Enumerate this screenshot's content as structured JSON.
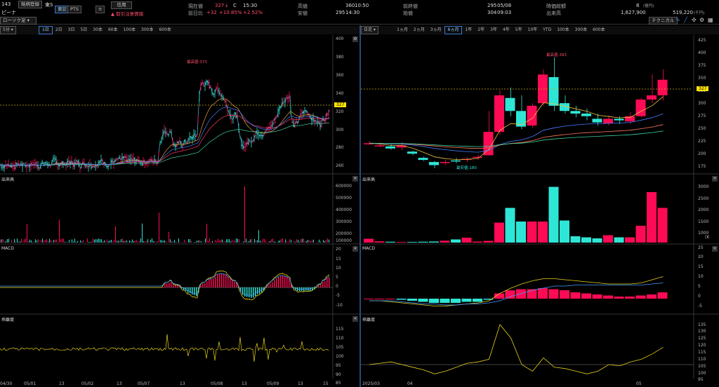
{
  "header": {
    "code": "143",
    "title": "ピーナ",
    "register_btn": "銘柄登録",
    "market": "東S",
    "tab_tse": "東証",
    "tab_pts": "PTS",
    "credit_btn": "信用",
    "warning": "▲ 取引注意情報",
    "chart_type": "ローソク足",
    "price_label": "現在値",
    "price": "327",
    "price_flag": "↓",
    "price_c": "C",
    "price_time": "15:30",
    "change_label": "前日比",
    "change": "+32",
    "change_pct": "+10.85%",
    "change2": "+2.52%",
    "high_label": "高値",
    "high": "360",
    "high_time": "10:50",
    "low_label": "安値",
    "low": "295",
    "low_time": "14:30",
    "prev_label": "前終値",
    "prev": "295",
    "prev_date": "05/08",
    "open_label": "始値",
    "open": "304",
    "open_time": "09:03",
    "mcap_label": "時価総額",
    "mcap": "8",
    "mcap_unit": "(億円)",
    "vol_label": "出来高",
    "vol": "1,627,900",
    "turnover": "519,220",
    "turnover_unit": "(千円)"
  },
  "left": {
    "interval": "5分",
    "tabs": [
      "1日",
      "2日",
      "3日",
      "5日",
      "30本",
      "60本",
      "100本",
      "300本",
      "600本"
    ],
    "active_tab": 0,
    "y_ticks": [
      "400",
      "380",
      "360",
      "340",
      "320",
      "300",
      "280",
      "260"
    ],
    "price_tag": "327",
    "high_annot": "最高値:373",
    "volume": {
      "title": "出来高",
      "ticks": [
        "600000",
        "500000",
        "400000",
        "300000",
        "200000",
        "100000"
      ]
    },
    "macd": {
      "title": "MACD",
      "ticks": [
        "20",
        "15",
        "10",
        "5",
        "0",
        "-5",
        "-10"
      ]
    },
    "kairi": {
      "title": "乖離度",
      "ticks": [
        "115",
        "110",
        "105",
        "100",
        "95",
        "90",
        "85"
      ]
    },
    "x_ticks": [
      "04/30",
      "05/01",
      "13",
      "05/02",
      "13",
      "05/07",
      "13",
      "05/08",
      "13",
      "05/09",
      "13",
      "15"
    ]
  },
  "right": {
    "interval": "日足",
    "tabs": [
      "1ヵ月",
      "2ヵ月",
      "3ヵ月",
      "6ヵ月",
      "1年",
      "2年",
      "3年",
      "4年",
      "5年",
      "10年",
      "YTD",
      "100本",
      "300本",
      "600本"
    ],
    "active_tab": 3,
    "tech_btn": "テクニカル",
    "y_ticks": [
      "425",
      "400",
      "375",
      "350",
      "325",
      "300",
      "275",
      "250",
      "225",
      "200",
      "175"
    ],
    "price_tag": "327",
    "high_annot": "最高値:393",
    "low_annot": "最安値:180",
    "volume": {
      "title": "出来高",
      "ticks": [
        "3000",
        "2500",
        "2000",
        "1500",
        "1000",
        "500"
      ],
      "unit": "(K"
    },
    "macd": {
      "title": "MACD",
      "ticks": [
        "25",
        "20",
        "15",
        "10",
        "5",
        "0",
        "-5"
      ]
    },
    "kairi": {
      "title": "乖離度",
      "ticks": [
        "135",
        "130",
        "125",
        "120",
        "115",
        "110",
        "105",
        "100",
        "95",
        "90"
      ]
    },
    "x_ticks": [
      "2025/03",
      "04",
      "05"
    ]
  },
  "colors": {
    "up": "#ff0a54",
    "down": "#2ee6d6",
    "accent": "#3a7bd5",
    "yellow": "#e6d21a"
  }
}
